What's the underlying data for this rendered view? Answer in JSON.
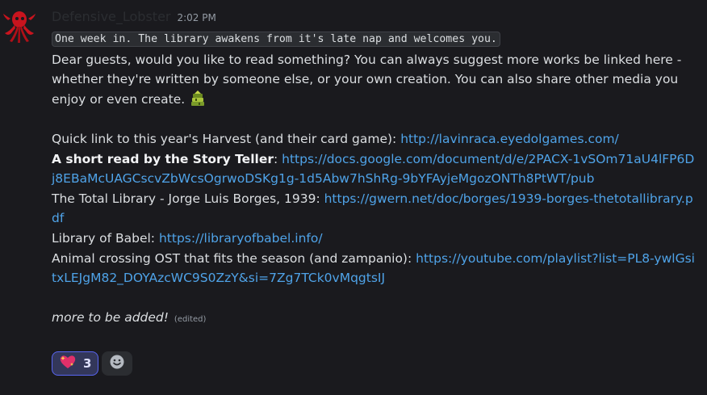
{
  "message": {
    "username": "Defensive_Lobster",
    "timestamp": "2:02 PM",
    "code_line": "One week in. The library awakens from it's late nap and welcomes you.",
    "intro_text": "Dear guests, would you like to read something? You can always suggest more works be linked here - whether they're written by someone else, or your own creation. You can also share other media you enjoy or even create.",
    "intro_emoji": "stack-of-books-emoji",
    "links": [
      {
        "label": "Quick link to this year's Harvest (and their card game): ",
        "url": "http://lavinraca.eyedolgames.com/"
      },
      {
        "label": "A short read by the Story Teller",
        "label_suffix": ": ",
        "url": "https://docs.google.com/document/d/e/2PACX-1vSOm71aU4lFP6Dj8EBaMcUAGCscvZbWcsOgrwoDSKg1g-1d5Abw7hShRg-9bYFAyjeMgozONTh8PtWT/pub"
      },
      {
        "label": "The Total Library - Jorge Luis Borges, 1939: ",
        "url": "https://gwern.net/doc/borges/1939-borges-thetotallibrary.pdf"
      },
      {
        "label": "Library of Babel: ",
        "url": "https://libraryofbabel.info/"
      },
      {
        "label": "Animal crossing OST that fits the season (and zampanio): ",
        "url": "https://youtube.com/playlist?list=PL8-ywlGsitxLEJgM82_DOYAzcWC9S0ZzY&si=7Zg7TCk0vMqgtsIJ"
      }
    ],
    "outro_text": "more to be added!",
    "edited_label": "(edited)"
  },
  "reactions": [
    {
      "emoji": "sparkling-heart-emoji",
      "count": "3",
      "active": true
    }
  ],
  "add_reaction_icon": "smiley-add-reaction-icon",
  "colors": {
    "background": "#1a1a1e",
    "text": "#dbdee1",
    "link": "#4fa3e8",
    "muted": "#949ba4",
    "reaction_active_bg": "#33375a",
    "reaction_active_border": "#5865f2"
  }
}
